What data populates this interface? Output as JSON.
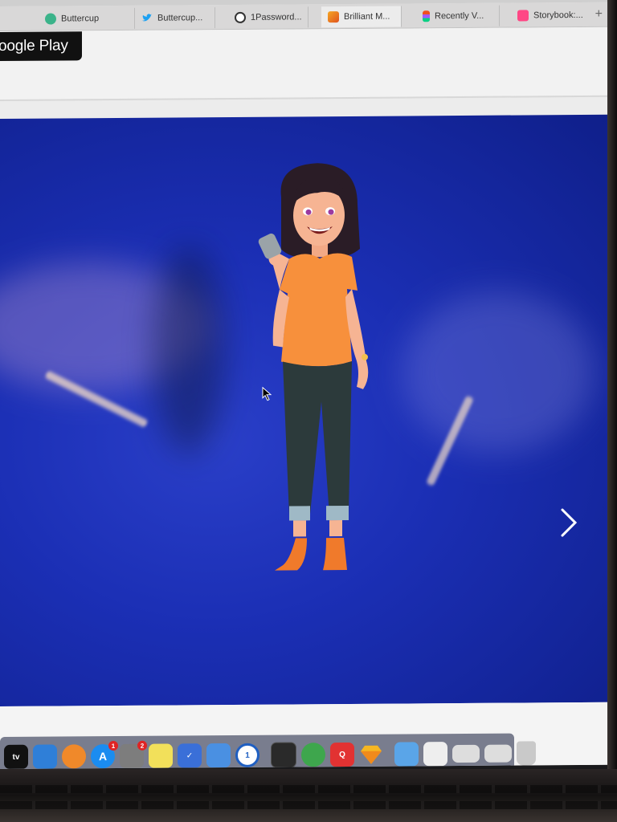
{
  "browser": {
    "tabs": [
      {
        "title": "Buttercup",
        "icon": "buttercup-icon",
        "color": "#3bb38a"
      },
      {
        "title": "Buttercup...",
        "icon": "twitter-icon",
        "color": "#1da1f2"
      },
      {
        "title": "1Password...",
        "icon": "1password-icon",
        "color": "#333333"
      },
      {
        "title": "Brilliant M...",
        "icon": "brilliant-icon",
        "color": "#f08a24"
      },
      {
        "title": "Recently V...",
        "icon": "figma-icon",
        "color": "#a259ff"
      },
      {
        "title": "Storybook:...",
        "icon": "storybook-icon",
        "color": "#ff4785"
      }
    ],
    "new_tab_label": "+"
  },
  "page": {
    "store_badge_text": "oogle Play",
    "hero_background": "#1b2fb5",
    "next_arrow": "›"
  },
  "dock": {
    "items": [
      {
        "name": "apple-tv-icon",
        "label": "tv",
        "color": "#111111"
      },
      {
        "name": "xcode-icon",
        "label": "",
        "color": "#2f7fd8"
      },
      {
        "name": "books-icon",
        "label": "",
        "color": "#f0892a"
      },
      {
        "name": "app-store-icon",
        "label": "",
        "color": "#1b8cf0",
        "badge": "1"
      },
      {
        "name": "system-preferences-icon",
        "label": "",
        "color": "#7d7d7d",
        "badge": "2"
      },
      {
        "name": "stickies-icon",
        "label": "",
        "color": "#f2e05a"
      },
      {
        "name": "things-icon",
        "label": "",
        "color": "#3a6fd8"
      },
      {
        "name": "bookmark-app-icon",
        "label": "",
        "color": "#4a90e2"
      },
      {
        "name": "1password-icon",
        "label": "1",
        "color": "#1f5fc2"
      },
      {
        "name": "activity-monitor-icon",
        "label": "",
        "color": "#2a2a2a"
      },
      {
        "name": "android-studio-icon",
        "label": "",
        "color": "#3ea64d"
      },
      {
        "name": "quip-icon",
        "label": "Q",
        "color": "#e23232"
      },
      {
        "name": "sketch-icon",
        "label": "",
        "color": "#f5b622"
      },
      {
        "name": "folder-icon",
        "label": "",
        "color": "#5aa5e8"
      },
      {
        "name": "preview-doc-icon",
        "label": "",
        "color": "#eeeeee"
      },
      {
        "name": "window-icon",
        "label": "",
        "color": "#dddddd"
      },
      {
        "name": "window-icon-2",
        "label": "",
        "color": "#dddddd"
      },
      {
        "name": "trash-icon",
        "label": "",
        "color": "#c9c9c9"
      }
    ]
  }
}
